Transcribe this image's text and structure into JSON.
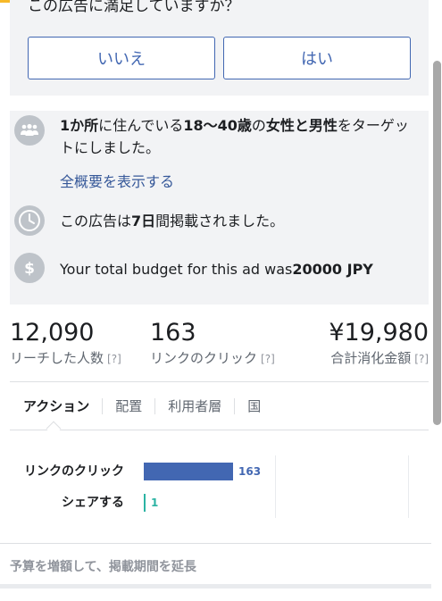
{
  "question": {
    "text": "この広告に満足していますか？",
    "no_label": "いいえ",
    "yes_label": "はい"
  },
  "info": {
    "targeting_bold_1": "1か所",
    "targeting_text_1": "に住んでいる",
    "targeting_bold_2": "18〜40歳",
    "targeting_text_2": "の",
    "targeting_bold_3": "女性と男性",
    "targeting_text_3": "をターゲットにしました。",
    "summary_link": "全概要を表示する",
    "duration_text_1": "この広告は",
    "duration_bold": "7日",
    "duration_text_2": "間掲載されました。",
    "budget_text": "Your total budget for this ad was",
    "budget_bold": "20000 JPY"
  },
  "stats": {
    "reach_value": "12,090",
    "reach_label": "リーチした人数",
    "clicks_value": "163",
    "clicks_label": "リンクのクリック",
    "spend_value": "¥19,980",
    "spend_label": "合計消化金額",
    "help": "[?]"
  },
  "tabs": {
    "actions": "アクション",
    "placement": "配置",
    "audience": "利用者層",
    "country": "国"
  },
  "chart_data": {
    "type": "bar",
    "categories": [
      "リンクのクリック",
      "シェアする"
    ],
    "values": [
      163,
      1
    ],
    "colors": [
      "#4267b2",
      "#2bb3a3"
    ],
    "xlim": [
      0,
      240
    ]
  },
  "footer": {
    "extend_label": "予算を増額して、掲載期間を延長"
  },
  "icons": {
    "audience": "people-icon",
    "duration": "clock-icon",
    "budget": "dollar-icon"
  }
}
